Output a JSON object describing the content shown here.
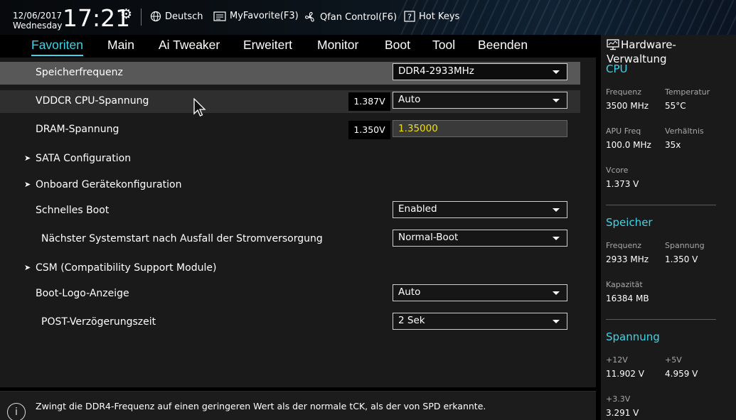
{
  "header": {
    "date": "12/06/2017",
    "weekday": "Wednesday",
    "time": "17:21",
    "language": "Deutsch",
    "myfavorite": "MyFavorite(F3)",
    "qfan": "Qfan Control(F6)",
    "hotkeys": "Hot Keys"
  },
  "tabs": [
    {
      "label": "Favoriten",
      "active": true
    },
    {
      "label": "Main"
    },
    {
      "label": "Ai Tweaker"
    },
    {
      "label": "Erweitert"
    },
    {
      "label": "Monitor"
    },
    {
      "label": "Boot"
    },
    {
      "label": "Tool"
    },
    {
      "label": "Beenden"
    }
  ],
  "settings": {
    "speicherfrequenz": {
      "label": "Speicherfrequenz",
      "value": "DDR4-2933MHz"
    },
    "vddcr": {
      "label": "VDDCR CPU-Spannung",
      "reading": "1.387V",
      "value": "Auto"
    },
    "dram": {
      "label": "DRAM-Spannung",
      "reading": "1.350V",
      "value": "1.35000"
    },
    "sata": {
      "label": "SATA Configuration"
    },
    "onboard": {
      "label": "Onboard Gerätekonfiguration"
    },
    "schnelles_boot": {
      "label": "Schnelles Boot",
      "value": "Enabled"
    },
    "naechster_start": {
      "label": "Nächster Systemstart nach Ausfall der Stromversorgung",
      "value": "Normal-Boot"
    },
    "csm": {
      "label": "CSM (Compatibility Support Module)"
    },
    "boot_logo": {
      "label": "Boot-Logo-Anzeige",
      "value": "Auto"
    },
    "post_delay": {
      "label": "POST-Verzögerungszeit",
      "value": "2 Sek"
    }
  },
  "help": {
    "text": "Zwingt die DDR4-Frequenz auf einen geringeren Wert als der normale tCK, als der von SPD erkannte."
  },
  "sidebar": {
    "title": "Hardware-Verwaltung",
    "cpu": {
      "title": "CPU",
      "freq_label": "Frequenz",
      "freq": "3500 MHz",
      "temp_label": "Temperatur",
      "temp": "55°C",
      "apu_label": "APU Freq",
      "apu": "100.0 MHz",
      "ratio_label": "Verhältnis",
      "ratio": "35x",
      "vcore_label": "Vcore",
      "vcore": "1.373 V"
    },
    "memory": {
      "title": "Speicher",
      "freq_label": "Frequenz",
      "freq": "2933 MHz",
      "volt_label": "Spannung",
      "volt": "1.350 V",
      "cap_label": "Kapazität",
      "cap": "16384 MB"
    },
    "voltage": {
      "title": "Spannung",
      "v12_label": "+12V",
      "v12": "11.902 V",
      "v5_label": "+5V",
      "v5": "4.959 V",
      "v33_label": "+3.3V",
      "v33": "3.291 V"
    }
  },
  "colors": {
    "accent": "#3fd4e7",
    "edit_value": "#f0e000"
  }
}
